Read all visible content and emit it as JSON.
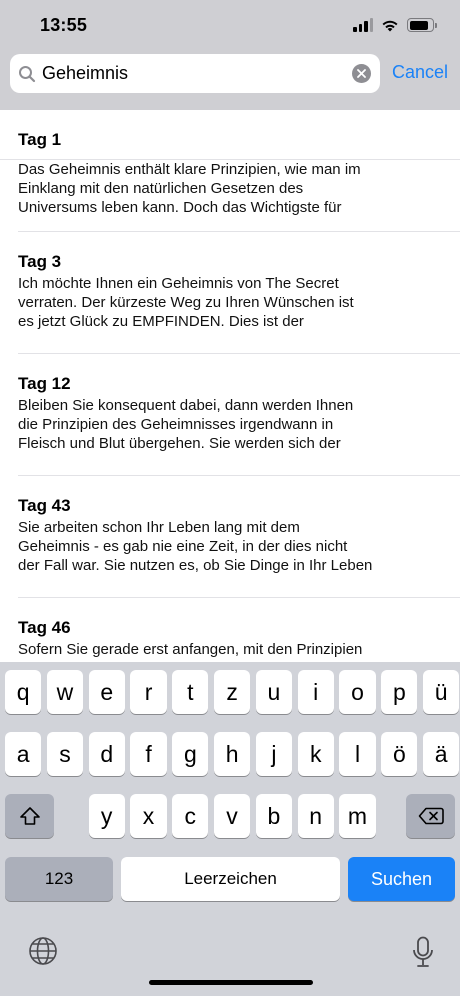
{
  "status_bar": {
    "time": "13:55",
    "icons": [
      "cellular-signal-icon",
      "wifi-icon",
      "battery-icon"
    ],
    "battery_level": 0.85
  },
  "search": {
    "value": "Geheimnis",
    "placeholder": "",
    "cancel_label": "Cancel"
  },
  "results": [
    {
      "title": "Tag 1",
      "lines": [
        "Das Geheimnis enthält klare Prinzipien, wie man im",
        "Einklang mit den natürlichen Gesetzen des",
        "Universums leben kann. Doch das Wichtigste für"
      ]
    },
    {
      "title": "Tag 3",
      "lines": [
        "Ich möchte Ihnen ein Geheimnis von The Secret",
        "verraten. Der kürzeste Weg zu Ihren Wünschen ist",
        "es jetzt Glück zu EMPFINDEN. Dies ist der"
      ]
    },
    {
      "title": "Tag 12",
      "lines": [
        "Bleiben Sie konsequent dabei, dann werden Ihnen",
        "die Prinzipien des Geheimnisses irgendwann in",
        "Fleisch und Blut übergehen. Sie werden sich der"
      ]
    },
    {
      "title": "Tag 43",
      "lines": [
        "Sie arbeiten schon Ihr Leben lang mit dem",
        "Geheimnis - es gab nie eine Zeit, in der dies nicht",
        "der Fall war. Sie nutzen es, ob Sie Dinge in Ihr Leben"
      ]
    },
    {
      "title": "Tag 46",
      "lines": [
        "Sofern Sie gerade erst anfangen, mit den Prinzipien"
      ]
    }
  ],
  "keyboard": {
    "row1": [
      "q",
      "w",
      "e",
      "r",
      "t",
      "z",
      "u",
      "i",
      "o",
      "p",
      "ü"
    ],
    "row2": [
      "a",
      "s",
      "d",
      "f",
      "g",
      "h",
      "j",
      "k",
      "l",
      "ö",
      "ä"
    ],
    "row3": [
      "y",
      "x",
      "c",
      "v",
      "b",
      "n",
      "m"
    ],
    "numbers_label": "123",
    "space_label": "Leerzeichen",
    "search_label": "Suchen",
    "accent_color": "#1a82f7"
  }
}
